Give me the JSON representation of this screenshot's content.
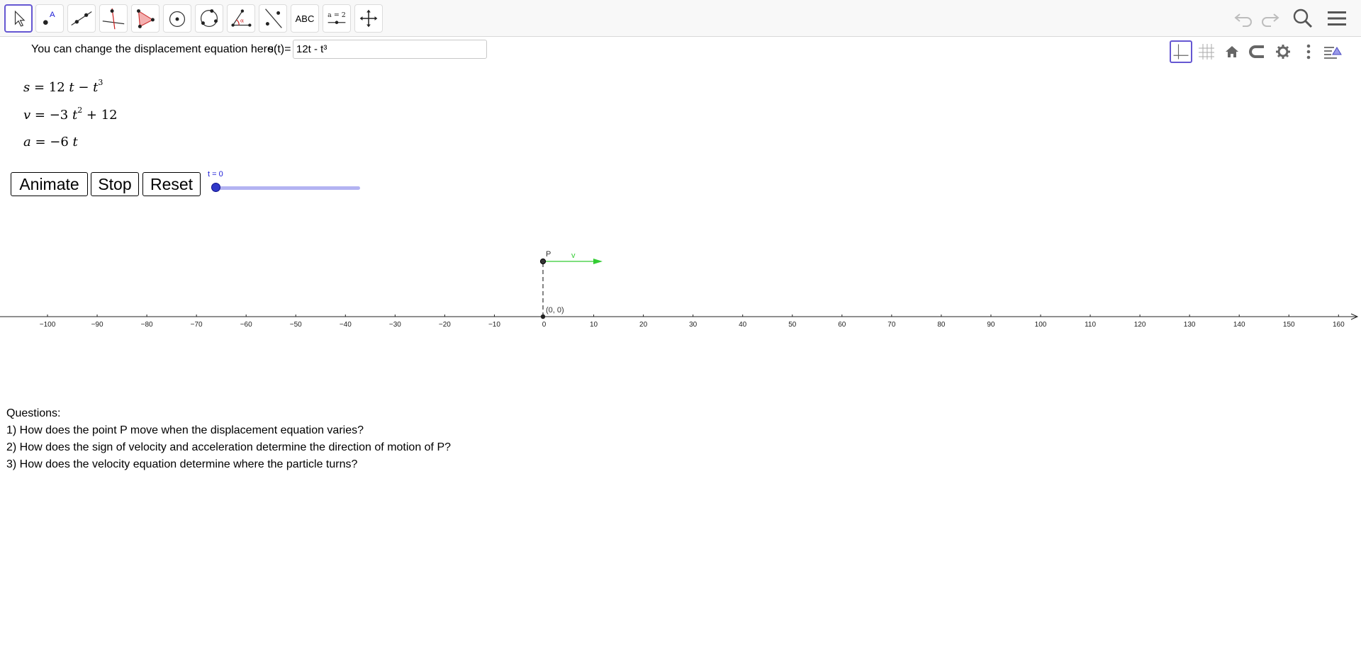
{
  "toolbar": {
    "tools": [
      {
        "name": "move-tool",
        "icon": "arrow-cursor-icon"
      },
      {
        "name": "point-tool",
        "icon": "point-icon",
        "label": "A"
      },
      {
        "name": "line-tool",
        "icon": "line-through-points-icon"
      },
      {
        "name": "perpendicular-line-tool",
        "icon": "perpendicular-line-icon"
      },
      {
        "name": "polygon-tool",
        "icon": "polygon-icon"
      },
      {
        "name": "circle-center-point-tool",
        "icon": "circle-center-icon"
      },
      {
        "name": "circle-three-points-tool",
        "icon": "circle-three-points-icon"
      },
      {
        "name": "angle-tool",
        "icon": "angle-icon"
      },
      {
        "name": "reflect-tool",
        "icon": "reflect-about-line-icon"
      },
      {
        "name": "text-tool",
        "icon": "text-icon",
        "label": "ABC"
      },
      {
        "name": "slider-tool",
        "icon": "slider-icon",
        "label": "a = 2"
      },
      {
        "name": "move-graphics-view-tool",
        "icon": "move-view-icon"
      }
    ],
    "right": [
      "undo-icon",
      "redo-icon",
      "search-icon",
      "menu-icon"
    ]
  },
  "style_bar": [
    "axes-toggle-icon",
    "grid-toggle-icon",
    "home-icon",
    "point-capturing-icon",
    "settings-icon",
    "more-vertical-icon",
    "algebra-view-toggle-icon"
  ],
  "input": {
    "label": "You can change the displacement equation here:",
    "prefix": "s(t)=",
    "value": "12t - t³"
  },
  "formulas": {
    "s": {
      "lhs": "s",
      "eq": " = 12 ",
      "t": "t",
      "minus": " − ",
      "t2": "t",
      "exp": "3"
    },
    "v": {
      "lhs": "v",
      "eq": " = −3 ",
      "t": "t",
      "exp": "2",
      "rest": " + 12"
    },
    "a": {
      "lhs": "a",
      "eq": " = −6 ",
      "t": "t"
    }
  },
  "buttons": {
    "animate": "Animate",
    "stop": "Stop",
    "reset": "Reset"
  },
  "slider": {
    "caption": "t = 0",
    "value": 0
  },
  "graph": {
    "x_ticks": [
      "−100",
      "−90",
      "−80",
      "−70",
      "−60",
      "−50",
      "−40",
      "−30",
      "−20",
      "−10",
      "0",
      "10",
      "20",
      "30",
      "40",
      "50",
      "60",
      "70",
      "80",
      "90",
      "100",
      "110",
      "120",
      "130",
      "140",
      "150",
      "160"
    ],
    "point_label": "P",
    "vector_label": "v",
    "origin_label": "(0, 0)",
    "accent_vector": "#33cc33"
  },
  "questions": {
    "title": "Questions:",
    "q1": "1) How does the point P move when the displacement equation varies?",
    "q2": "2) How does the sign of velocity and acceleration determine the direction of motion of P?",
    "q3": "3) How does the velocity equation determine where the particle turns?"
  }
}
